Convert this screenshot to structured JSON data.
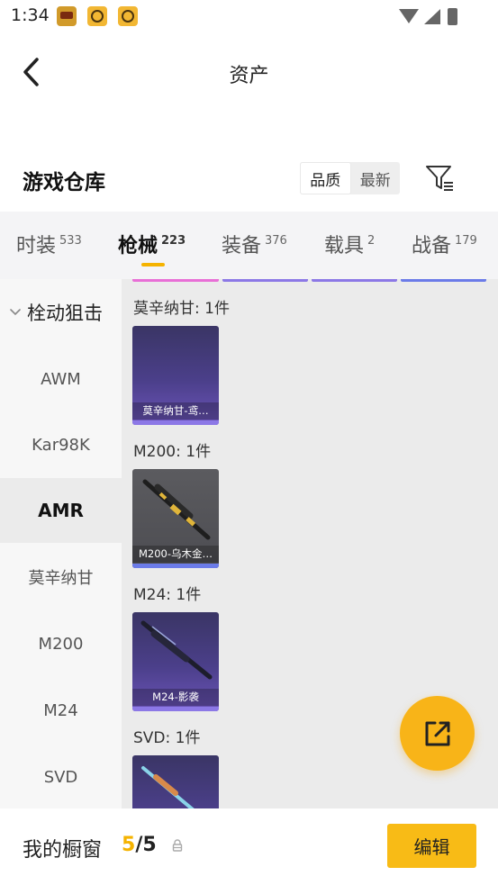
{
  "status_bar": {
    "time": "1:34"
  },
  "header": {
    "title": "资产"
  },
  "warehouse": {
    "title": "游戏仓库",
    "sort_options": [
      "品质",
      "最新"
    ],
    "active_sort": "品质"
  },
  "tabs": [
    {
      "label": "时装",
      "count": "533"
    },
    {
      "label": "枪械",
      "count": "223",
      "active": true
    },
    {
      "label": "装备",
      "count": "376"
    },
    {
      "label": "载具",
      "count": "2"
    },
    {
      "label": "战备",
      "count": "179"
    }
  ],
  "sidebar": {
    "group": "栓动狙击",
    "items": [
      "AWM",
      "Kar98K",
      "AMR",
      "莫辛纳甘",
      "M200",
      "M24",
      "SVD"
    ],
    "active": "AMR"
  },
  "sections": [
    {
      "title": "莫辛纳甘: 1件",
      "card_name": "莫辛纳甘-鸢…"
    },
    {
      "title": "M200: 1件",
      "card_name": "M200-乌木金…"
    },
    {
      "title": "M24: 1件",
      "card_name": "M24-影袭"
    },
    {
      "title": "SVD: 1件",
      "card_name": ""
    }
  ],
  "bottom": {
    "showcase_label": "我的橱窗",
    "showcase_current": "5",
    "showcase_sep": "/",
    "showcase_total": "5",
    "edit_label": "编辑"
  },
  "colors": {
    "accent": "#f8bb16",
    "rarity_pink": "#e86fd6",
    "rarity_purple": "#8c78e6",
    "rarity_blue": "#6b7be8"
  },
  "icons": {
    "back": "chevron-left-icon",
    "filter": "filter-icon",
    "share": "share-external-icon",
    "lock": "lock-icon"
  }
}
